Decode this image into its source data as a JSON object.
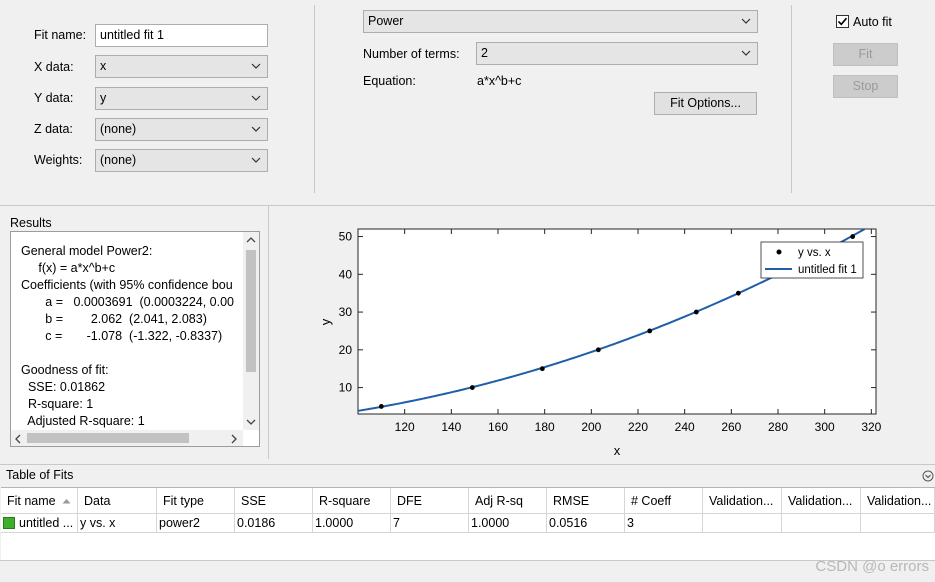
{
  "fit_panel": {
    "fit_name_label": "Fit name:",
    "fit_name_value": "untitled fit 1",
    "x_data_label": "X data:",
    "x_data_value": "x",
    "y_data_label": "Y data:",
    "y_data_value": "y",
    "z_data_label": "Z data:",
    "z_data_value": "(none)",
    "weights_label": "Weights:",
    "weights_value": "(none)"
  },
  "model_panel": {
    "model_type": "Power",
    "num_terms_label": "Number of terms:",
    "num_terms_value": "2",
    "equation_label": "Equation:",
    "equation_value": "a*x^b+c",
    "fit_options_label": "Fit Options..."
  },
  "controls": {
    "auto_fit_label": "Auto fit",
    "auto_fit_checked": true,
    "fit_label": "Fit",
    "stop_label": "Stop"
  },
  "results": {
    "title": "Results",
    "lines": [
      "General model Power2:",
      "     f(x) = a*x^b+c",
      "Coefficients (with 95% confidence bou",
      "       a =   0.0003691  (0.0003224, 0.00",
      "       b =        2.062  (2.041, 2.083)",
      "       c =       -1.078  (-1.322, -0.8337)",
      "",
      "Goodness of fit:",
      "  SSE: 0.01862",
      "  R-square: 1",
      "  Adjusted R-square: 1"
    ]
  },
  "chart_data": {
    "type": "scatter",
    "xlabel": "x",
    "ylabel": "y",
    "xlim": [
      100,
      322
    ],
    "ylim": [
      3,
      52
    ],
    "xticks": [
      120,
      140,
      160,
      180,
      200,
      220,
      240,
      260,
      280,
      300,
      320
    ],
    "yticks": [
      10,
      20,
      30,
      40,
      50
    ],
    "legend_placement": "top-right",
    "series": [
      {
        "name": "y vs. x",
        "kind": "points",
        "color": "#000000",
        "x": [
          110,
          149,
          179,
          203,
          225,
          245,
          263,
          296,
          312
        ],
        "y": [
          5,
          10,
          15,
          20,
          25,
          30,
          35,
          45,
          50
        ]
      },
      {
        "name": "untitled fit 1",
        "kind": "line",
        "color": "#1f5fa8",
        "model": {
          "a": 0.0003691,
          "b": 2.062,
          "c": -1.078
        }
      }
    ]
  },
  "table_of_fits": {
    "title": "Table of Fits",
    "columns": [
      "Fit name",
      "Data",
      "Fit type",
      "SSE",
      "R-square",
      "DFE",
      "Adj R-sq",
      "RMSE",
      "# Coeff",
      "Validation...",
      "Validation...",
      "Validation..."
    ],
    "rows": [
      [
        "untitled ...",
        "y vs. x",
        "power2",
        "0.0186",
        "1.0000",
        "7",
        "1.0000",
        "0.0516",
        "3",
        "",
        "",
        ""
      ]
    ]
  },
  "watermark": "CSDN @o errors"
}
